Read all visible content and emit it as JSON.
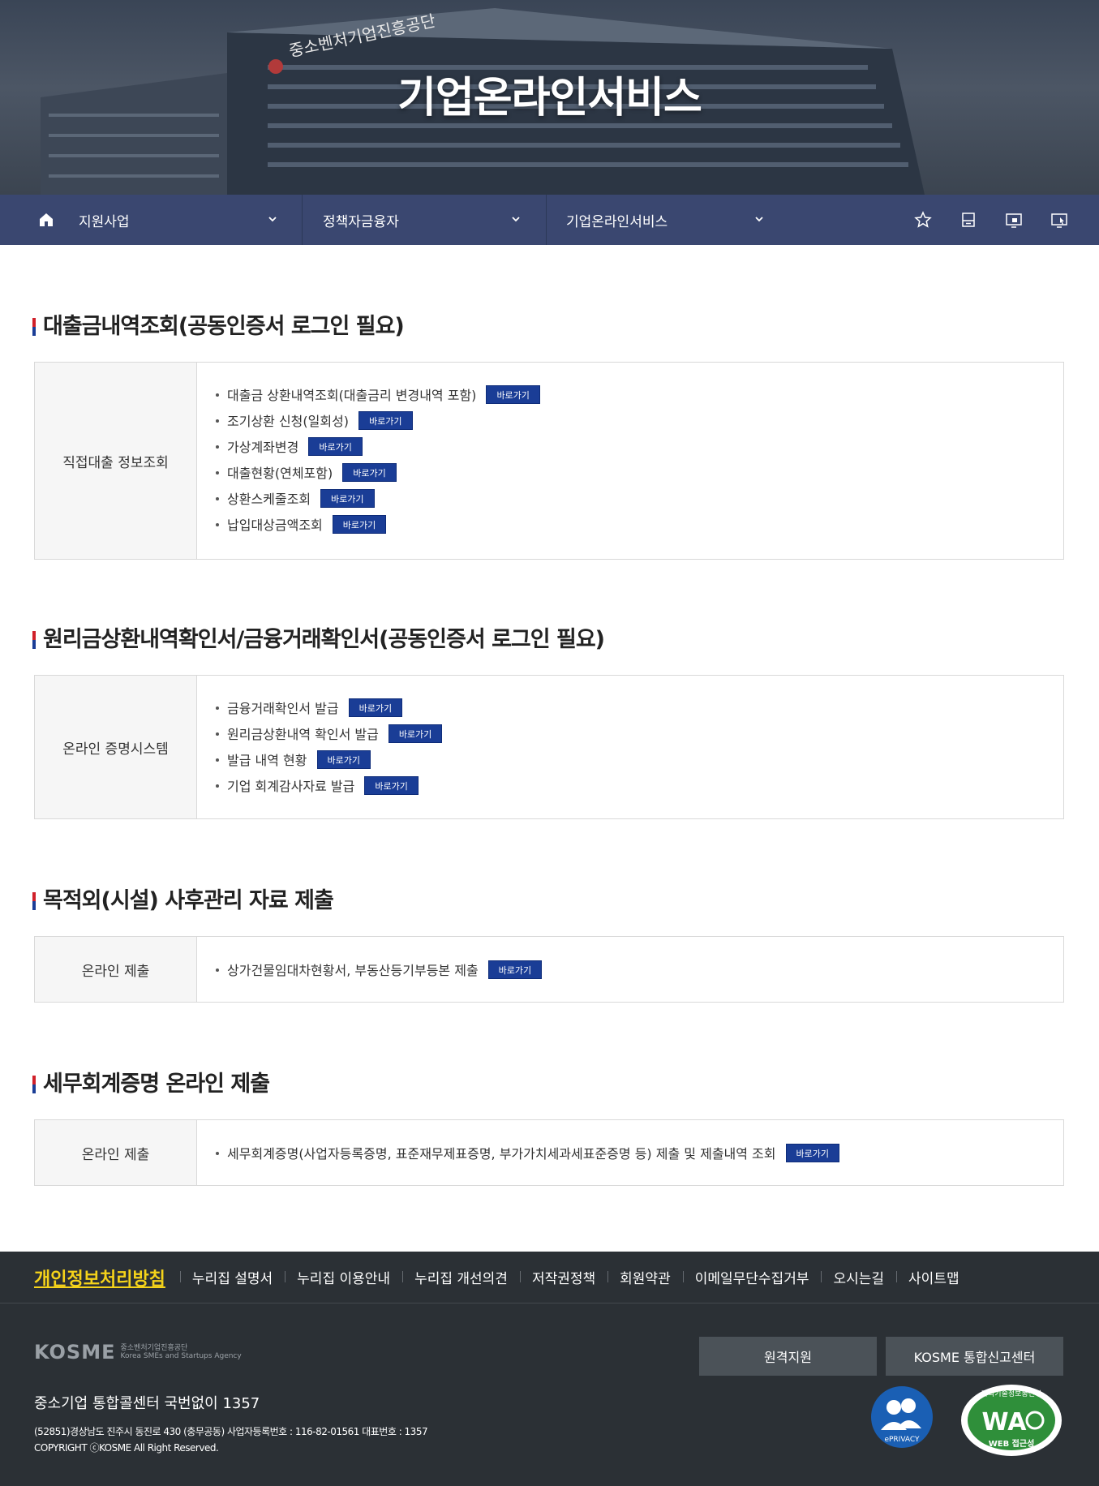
{
  "hero": {
    "title": "기업온라인서비스",
    "building_sign": "중소벤처기업진흥공단"
  },
  "nav": {
    "menus": [
      {
        "label": "지원사업"
      },
      {
        "label": "정책자금융자"
      },
      {
        "label": "기업온라인서비스"
      }
    ],
    "tools": [
      "star-icon",
      "print-icon",
      "monitor-icon",
      "screen-icon"
    ]
  },
  "sections": [
    {
      "title": "대출금내역조회(공동인증서 로그인 필요)",
      "header": "직접대출 정보조회",
      "items": [
        {
          "text": "대출금 상환내역조회(대출금리 변경내역 포함)",
          "button": "바로가기"
        },
        {
          "text": "조기상환 신청(일회성)",
          "button": "바로가기"
        },
        {
          "text": "가상계좌변경",
          "button": "바로가기"
        },
        {
          "text": "대출현황(연체포함)",
          "button": "바로가기"
        },
        {
          "text": "상환스케줄조회",
          "button": "바로가기"
        },
        {
          "text": "납입대상금액조회",
          "button": "바로가기"
        }
      ]
    },
    {
      "title": "원리금상환내역확인서/금융거래확인서(공동인증서 로그인 필요)",
      "header": "온라인 증명시스템",
      "items": [
        {
          "text": "금융거래확인서 발급",
          "button": "바로가기"
        },
        {
          "text": "원리금상환내역 확인서 발급",
          "button": "바로가기"
        },
        {
          "text": "발급 내역 현황",
          "button": "바로가기"
        },
        {
          "text": "기업 회계감사자료 발급",
          "button": "바로가기"
        }
      ]
    },
    {
      "title": "목적외(시설) 사후관리 자료 제출",
      "header": "온라인 제출",
      "items": [
        {
          "text": "상가건물임대차현황서, 부동산등기부등본 제출",
          "button": "바로가기"
        }
      ]
    },
    {
      "title": "세무회계증명 온라인 제출",
      "header": "온라인 제출",
      "items": [
        {
          "text": "세무회계증명(사업자등록증명, 표준재무제표증명, 부가가치세과세표준증명 등) 제출 및 제출내역 조회",
          "button": "바로가기"
        }
      ]
    }
  ],
  "footer": {
    "privacy": "개인정보처리방침",
    "links": [
      "누리집 설명서",
      "누리집 이용안내",
      "누리집 개선의견",
      "저작권정책",
      "회원약관",
      "이메일무단수집거부",
      "오시는길",
      "사이트맵"
    ],
    "logo": "KOSME",
    "logo_sub1": "중소벤처기업진흥공단",
    "logo_sub2": "Korea SMEs and Startups Agency",
    "callcenter": "중소기업 통합콜센터 국번없이 1357",
    "address": "(52851)경상남도 진주시 동진로 430 (충무공동) 사업자등록번호 : 116-82-01561 대표번호 : 1357",
    "copyright": "COPYRIGHT ⓒKOSME All Right Reserved.",
    "buttons": [
      "원격지원",
      "KOSME 통합신고센터"
    ],
    "eprivacy": "ePRIVACY",
    "wa_top": "과학기술정보통신부",
    "wa_main": "WA",
    "wa_bottom": "WEB 접근성"
  },
  "colors": {
    "nav": "#3a4770",
    "button": "#1a3d96",
    "footer": "#2b3035",
    "privacy": "#f5d31a"
  }
}
